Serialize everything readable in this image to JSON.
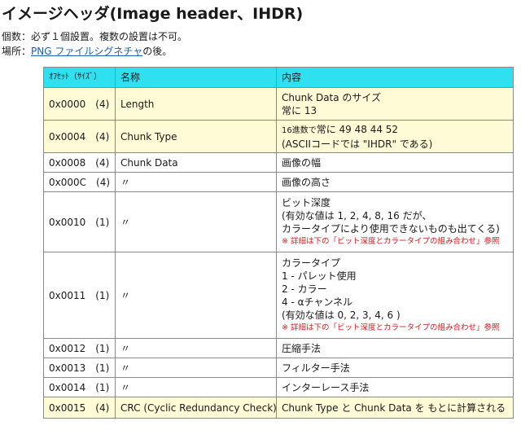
{
  "title": "イメージヘッダ(Image header、IHDR)",
  "count_line": "個数：必ず１個設置。複数の設置は不可。",
  "location_label": "場所：",
  "location_link": "PNG ファイルシグネチャ",
  "location_suffix": "の後。",
  "table": {
    "headers": {
      "offset": "ｵﾌｾｯﾄ（ｻｲｽﾞ）",
      "name": "名称",
      "content": "内容"
    },
    "rows": [
      {
        "offset": "0x0000",
        "size": "(4)",
        "name": "Length",
        "lines": [
          "Chunk Data のサイズ",
          "常に 13"
        ]
      },
      {
        "offset": "0x0004",
        "size": "(4)",
        "name": "Chunk Type",
        "lines_prefix": "16進数で",
        "lines": [
          "常に 49 48 44 52",
          "(ASCIIコードでは \"IHDR\" である)"
        ]
      },
      {
        "offset": "0x0008",
        "size": "(4)",
        "name": "Chunk Data",
        "lines": [
          "画像の幅"
        ]
      },
      {
        "offset": "0x000C",
        "size": "(4)",
        "name": "〃",
        "lines": [
          "画像の高さ"
        ]
      },
      {
        "offset": "0x0010",
        "size": "(1)",
        "name": "〃",
        "lines": [
          "ビット深度",
          "(有効な値は 1, 2, 4, 8, 16 だが、",
          "カラータイプにより使用できないものも出てくる)"
        ],
        "note": "※ 詳細は下の「ビット深度とカラータイプの組み合わせ」参照"
      },
      {
        "offset": "0x0011",
        "size": "(1)",
        "name": "〃",
        "lines": [
          "カラータイプ",
          "1 - パレット使用",
          "2 - カラー",
          "4 - αチャンネル",
          "(有効な値は 0, 2, 3, 4, 6 )"
        ],
        "note": "※ 詳細は下の「ビット深度とカラータイプの組み合わせ」参照"
      },
      {
        "offset": "0x0012",
        "size": "(1)",
        "name": "〃",
        "lines": [
          "圧縮手法"
        ]
      },
      {
        "offset": "0x0013",
        "size": "(1)",
        "name": "〃",
        "lines": [
          "フィルター手法"
        ]
      },
      {
        "offset": "0x0014",
        "size": "(1)",
        "name": "〃",
        "lines": [
          "インターレース手法"
        ]
      },
      {
        "offset": "0x0015",
        "size": "(4)",
        "name": "CRC (Cyclic Redundancy Check)",
        "lines": [
          "Chunk Type と Chunk Data を もとに計算される"
        ]
      }
    ]
  },
  "colors": {
    "header_bg": "#2ee0f0",
    "highlight_bg": "#fffbd6",
    "note_red": "#d42020",
    "link_blue": "#1a5fb4"
  }
}
